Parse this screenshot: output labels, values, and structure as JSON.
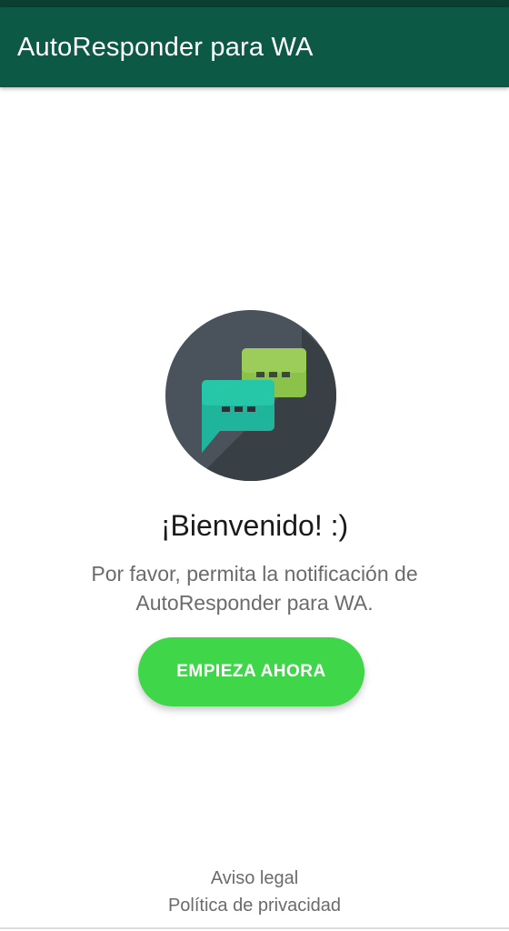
{
  "app_bar": {
    "title": "AutoResponder para WA"
  },
  "logo": {
    "icon": "chat-bubbles-icon",
    "colors": {
      "circle": "#4a535b",
      "shadow": "#353c42",
      "back_bubble": "#8bc34a",
      "front_bubble": "#1fb59d"
    }
  },
  "welcome": {
    "heading": "¡Bienvenido! :)",
    "message": "Por favor, permita la notificación de AutoResponder para WA."
  },
  "actions": {
    "start_label": "EMPIEZA AHORA"
  },
  "footer": {
    "legal_label": "Aviso legal",
    "privacy_label": "Política de privacidad"
  },
  "colors": {
    "app_bar": "#0c5a45",
    "status_bar": "#0a3f32",
    "button": "#3fd64a"
  }
}
